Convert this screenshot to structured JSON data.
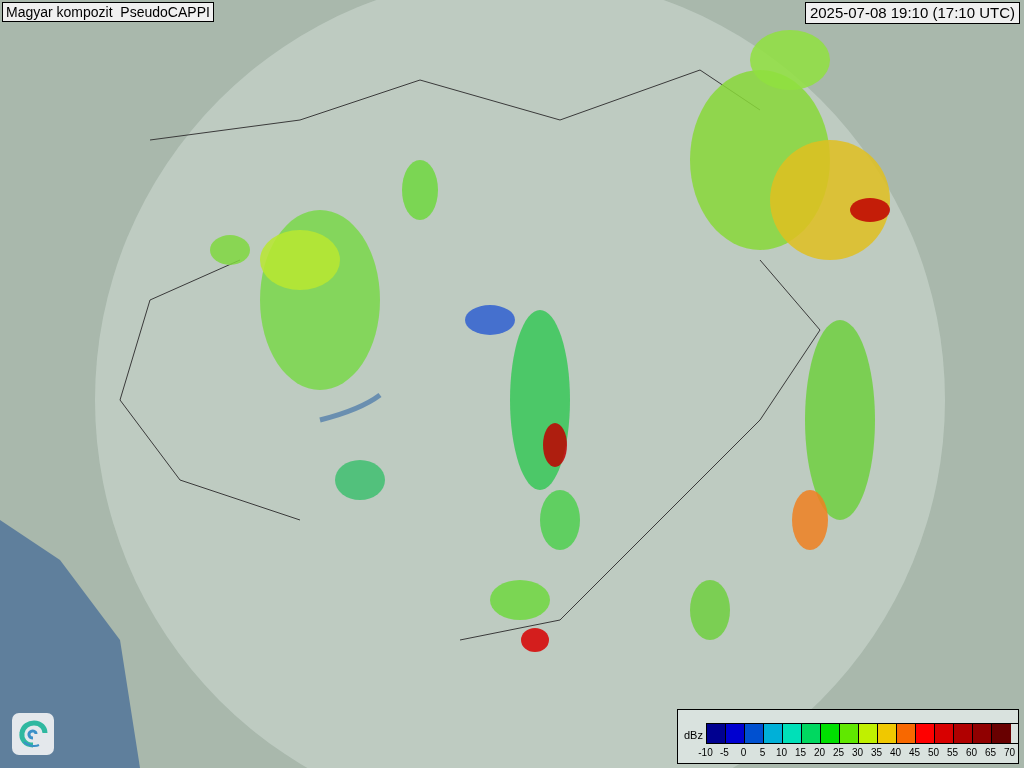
{
  "title": "Magyar kompozit  PseudoCAPPI",
  "timestamp": "2025-07-08 19:10 (17:10 UTC)",
  "legend": {
    "unit": "dBz",
    "bins": [
      {
        "color": "#000090"
      },
      {
        "color": "#0000d0"
      },
      {
        "color": "#0050d0"
      },
      {
        "color": "#00b0d8"
      },
      {
        "color": "#00e0b8"
      },
      {
        "color": "#00d860"
      },
      {
        "color": "#00e000"
      },
      {
        "color": "#60e800"
      },
      {
        "color": "#c0f000"
      },
      {
        "color": "#f0c800"
      },
      {
        "color": "#f86800"
      },
      {
        "color": "#ff0000"
      },
      {
        "color": "#d80000"
      },
      {
        "color": "#b00000"
      },
      {
        "color": "#900000"
      },
      {
        "color": "#680000"
      }
    ],
    "ticks": [
      "-10",
      "-5",
      "0",
      "5",
      "10",
      "15",
      "20",
      "25",
      "30",
      "35",
      "40",
      "45",
      "50",
      "55",
      "60",
      "65",
      "70"
    ]
  }
}
